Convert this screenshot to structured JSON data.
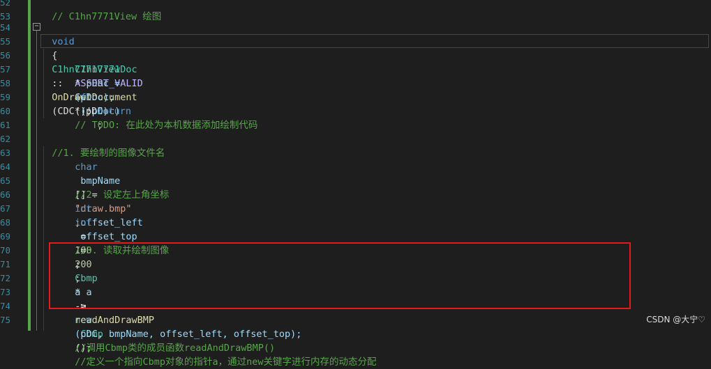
{
  "line_numbers": [
    "52",
    "53",
    "54",
    "55",
    "56",
    "57",
    "58",
    "59",
    "60",
    "61",
    "62",
    "63",
    "64",
    "65",
    "66",
    "67",
    "68",
    "69",
    "70",
    "71",
    "72",
    "73",
    "74",
    "75"
  ],
  "code": {
    "l52": "// C1hn7771View 绘图",
    "l54_kw": "void",
    "l54_class": "C1hn7771View",
    "l54_sep": "::",
    "l54_fn": "OnDraw",
    "l54_args": "(CDC* pDC)",
    "l55": "{",
    "l56_type": "C1hn7771Doc",
    "l56_rest": "* pDoc = ",
    "l56_fn": "GetDocument",
    "l56_end": "();",
    "l57_macro": "ASSERT_VALID",
    "l57_args": "(pDoc);",
    "l58_kw": "if",
    "l58_rest": " (!pDoc)",
    "l59_kw": "return",
    "l59_end": ";",
    "l60": "// TODO: 在此处为本机数据添加绘制代码",
    "l62": "//1. 要绘制的图像文件名",
    "l63_kw": "char",
    "l63_var": " bmpName",
    "l63_mid": "[] = ",
    "l63_str": "\"draw.bmp\"",
    "l63_end": ";",
    "l65": "//2. 设定左上角坐标",
    "l66_kw": "int",
    "l66_var": " offset_left",
    "l66_mid": " = ",
    "l66_num": "100",
    "l66_end": ";",
    "l67_kw": "int",
    "l67_var": " offset_top",
    "l67_mid": " = ",
    "l67_num": "200",
    "l67_end": ";",
    "l69": "//3. 读取并绘制图像",
    "l71_type": "Cbmp",
    "l71_var": "* a",
    "l71_mid": " = ",
    "l71_kw": "new",
    "l71_type2": " Cbmp",
    "l71_end": "();",
    "l71_cm": "//定义一个指向Cbmp对象的指针a，通过new关键字进行内存的动态分配",
    "l72_var": "a",
    "l72_arrow": "->",
    "l72_fn": "readAndDrawBMP",
    "l72_args": "(pDC, bmpName, offset_left, offset_top);",
    "l72_cm": "//调用Cbmp类的成员函数readAndDrawBMP()"
  },
  "watermark": "CSDN @大宁♡",
  "colors": {
    "background": "#1e1e1e",
    "comment": "#57a64a",
    "keyword": "#569cd6",
    "highlight_box": "#e31b1b"
  }
}
